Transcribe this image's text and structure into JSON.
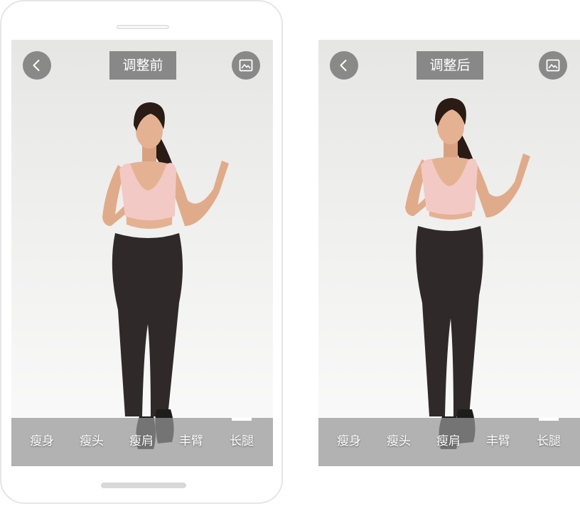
{
  "before_screen": {
    "title": "调整前",
    "back_icon": "chevron-left-icon",
    "gallery_icon": "image-icon",
    "tools": [
      "瘦身",
      "瘦头",
      "瘦肩",
      "丰臂",
      "长腿"
    ],
    "active_tool": "长腿"
  },
  "after_screen": {
    "title": "调整后",
    "back_icon": "chevron-left-icon",
    "gallery_icon": "image-icon",
    "tools": [
      "瘦身",
      "瘦头",
      "瘦肩",
      "丰臂",
      "长腿"
    ],
    "active_tool": "长腿"
  },
  "colors": {
    "top_pink": "#f2c9c4",
    "leggings": "#2f2a29",
    "skin": "#e0ab8a",
    "hair": "#2a1b15",
    "shoes": "#1d1d1d"
  }
}
